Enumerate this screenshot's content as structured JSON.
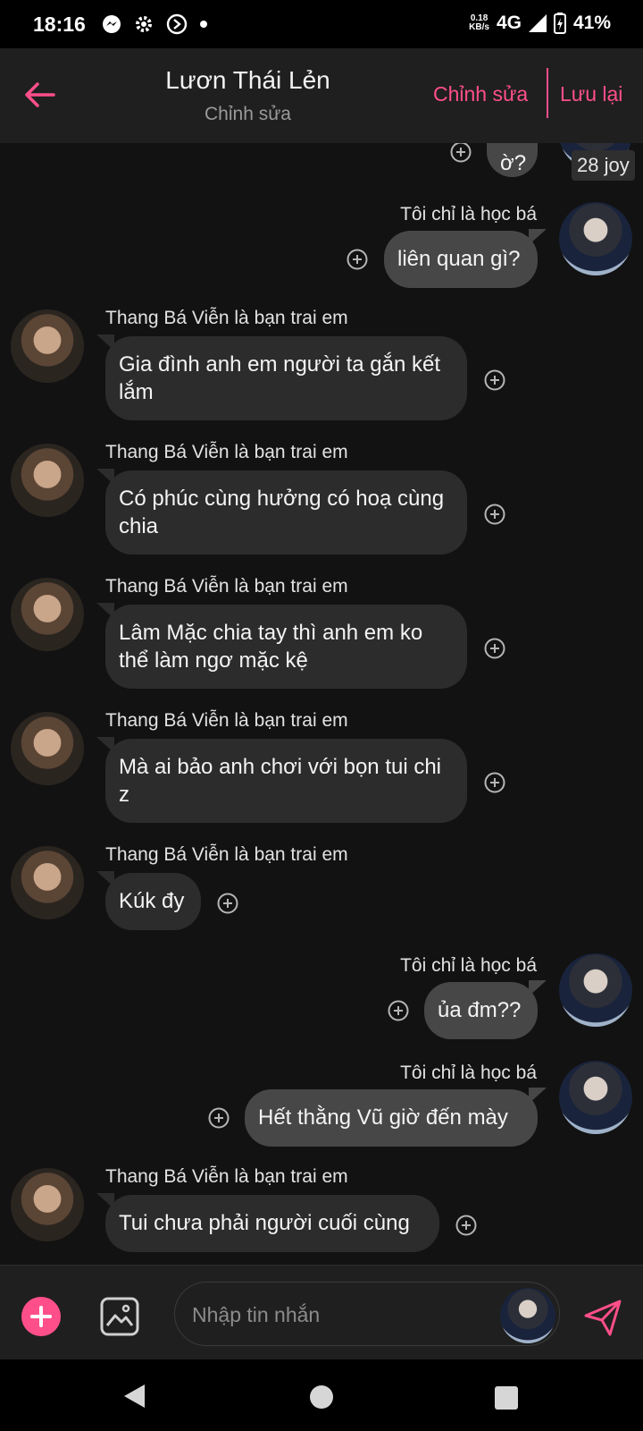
{
  "status": {
    "time": "18:16",
    "speed_value": "0.18",
    "speed_unit": "KB/s",
    "network": "4G",
    "battery": "41%"
  },
  "header": {
    "title": "Lươn Thái Lẻn",
    "subtitle": "Chỉnh sửa",
    "edit_label": "Chỉnh sửa",
    "save_label": "Lưu lại"
  },
  "messages": [
    {
      "side": "me",
      "text": "ờ?",
      "partial": true
    },
    {
      "side": "me",
      "sender": "Tôi chỉ là học bá",
      "text": "liên quan gì?"
    },
    {
      "side": "them",
      "sender": "Thang Bá Viễn là bạn trai em",
      "text": "Gia đình anh em người ta gắn kết lắm"
    },
    {
      "side": "them",
      "sender": "Thang Bá Viễn là bạn trai em",
      "text": "Có phúc cùng hưởng có hoạ cùng chia"
    },
    {
      "side": "them",
      "sender": "Thang Bá Viễn là bạn trai em",
      "text": "Lâm Mặc chia tay thì anh em ko thể làm ngơ mặc kệ"
    },
    {
      "side": "them",
      "sender": "Thang Bá Viễn là bạn trai em",
      "text": "Mà ai bảo anh chơi với bọn tui chi z"
    },
    {
      "side": "them",
      "sender": "Thang Bá Viễn là bạn trai em",
      "text": "Kúk đy"
    },
    {
      "side": "me",
      "sender": "Tôi chỉ là học bá",
      "text": "ủa đm??"
    },
    {
      "side": "me",
      "sender": "Tôi chỉ là học bá",
      "text": "Hết thằng Vũ giờ đến mày"
    },
    {
      "side": "them",
      "sender": "Thang Bá Viễn là bạn trai em",
      "text": "Tui chưa phải người cuối cùng"
    }
  ],
  "partial_badge": "28 joy",
  "composer": {
    "placeholder": "Nhập tin nhắn"
  },
  "colors": {
    "accent": "#ff4f8b",
    "header_bg": "#1f1f1f",
    "chat_bg": "#121212",
    "bubble_them": "#2c2c2c",
    "bubble_me": "#474747"
  },
  "icons": {
    "back": "arrow-left-icon",
    "add": "plus-circle-icon",
    "image": "image-icon",
    "send": "send-icon",
    "reaction": "add-reaction-icon"
  }
}
